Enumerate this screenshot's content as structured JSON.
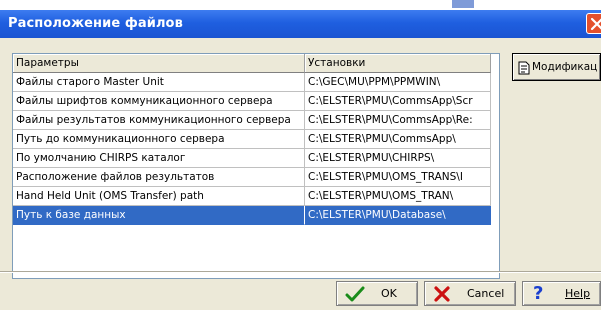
{
  "window": {
    "title": "Расположение файлов"
  },
  "table": {
    "headers": [
      "Параметры",
      "Установки"
    ],
    "rows": [
      {
        "param": "Файлы старого Master Unit",
        "value": "C:\\GEC\\MU\\PPM\\PPMWIN\\"
      },
      {
        "param": "Файлы шрифтов коммуникационного сервера",
        "value": "C:\\ELSTER\\PMU\\CommsApp\\Scr"
      },
      {
        "param": "Файлы результатов коммуникационного сервера",
        "value": "C:\\ELSTER\\PMU\\CommsApp\\Re:"
      },
      {
        "param": "Путь до коммуникационного сервера",
        "value": "C:\\ELSTER\\PMU\\CommsApp\\"
      },
      {
        "param": "По умолчанию CHIRPS каталог",
        "value": "C:\\ELSTER\\PMU\\CHIRPS\\"
      },
      {
        "param": "Расположение файлов результатов",
        "value": "C:\\ELSTER\\PMU\\OMS_TRANS\\I"
      },
      {
        "param": "Hand Held Unit (OMS Transfer) path",
        "value": "C:\\ELSTER\\PMU\\OMS_TRAN\\"
      },
      {
        "param": "Путь к базе данных",
        "value": "C:\\ELSTER\\PMU\\Database\\",
        "selected": true
      }
    ]
  },
  "buttons": {
    "modify": "Модификац",
    "ok": "OK",
    "cancel": "Cancel",
    "help": "Help"
  },
  "colors": {
    "titlebar": "#1f5fe0",
    "selection": "#316ac5",
    "face": "#ece9d8",
    "close": "#e4502c"
  },
  "icons": {
    "ok": "green-checkmark-icon",
    "cancel": "red-x-icon",
    "help": "blue-question-mark-icon",
    "modify": "edit-document-icon",
    "close": "close-icon"
  }
}
